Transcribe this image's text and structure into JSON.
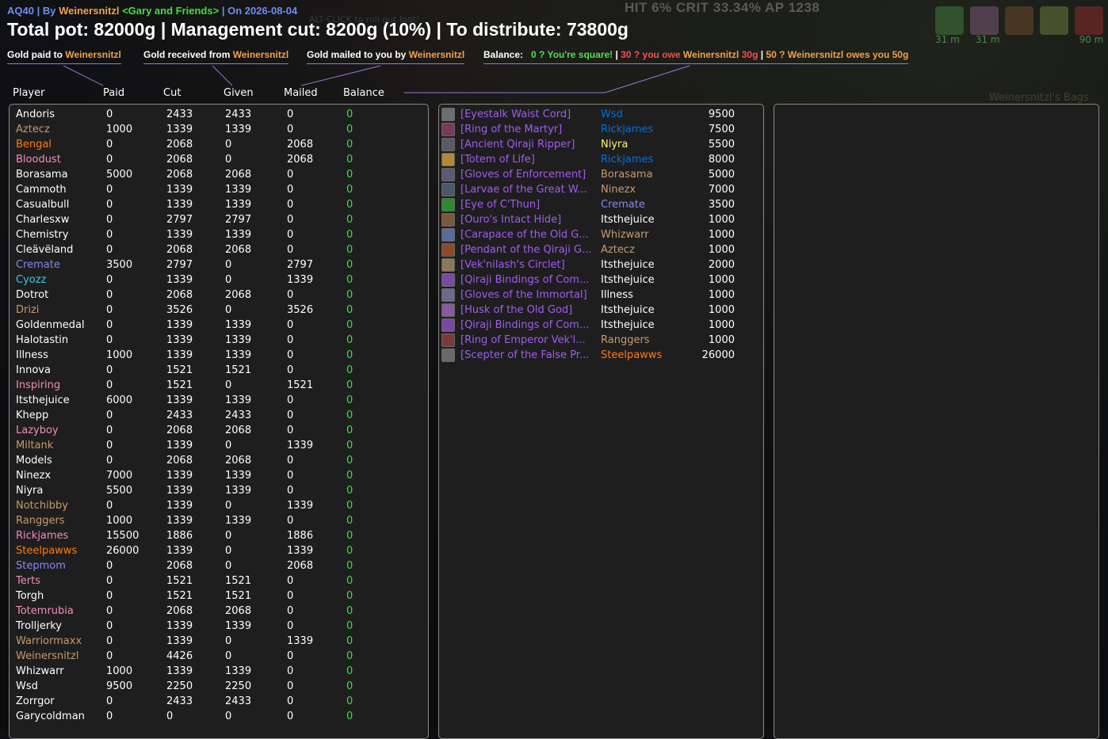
{
  "header": {
    "raid": "AQ40",
    "by_label": "By",
    "author": "Weinersnitzl",
    "guild": "<Gary and Friends>",
    "on_label": "On",
    "date": "2026-08-04",
    "title": "Total pot: 82000g | Management cut: 8200g (10%) | To distribute: 73800g"
  },
  "background": {
    "hud_stats": "HIT 6%  CRIT 33.34%   AP 1238",
    "alt_hint": "ALT-CLICK to roll out loot!",
    "bags_title": "Weinersnitzl's Bags",
    "timers": [
      "31 m",
      "31 m",
      "",
      "",
      "90 m"
    ]
  },
  "legend": {
    "paid_prefix": "Gold paid to",
    "paid_name": "Weinersnitzl",
    "received_prefix": "Gold received from",
    "received_name": "Weinersnitzl",
    "mailed_prefix": "Gold mailed to you by",
    "mailed_name": "Weinersnitzl",
    "balance_label": "Balance:",
    "bal_zero": "0 ? You're square!",
    "bal_sep1": "|",
    "bal_neg_a": "30 ? you owe",
    "bal_neg_name": "Weinersnitzl",
    "bal_neg_b": "30g",
    "bal_sep2": "|",
    "bal_pos_a": "50 ? Weinersnitzl",
    "bal_pos_b": "owes you 50g"
  },
  "columns": {
    "player": "Player",
    "paid": "Paid",
    "cut": "Cut",
    "given": "Given",
    "mailed": "Mailed",
    "balance": "Balance"
  },
  "players": [
    {
      "name": "Andoris",
      "color": "#ffffff",
      "paid": "0",
      "cut": "2433",
      "given": "2433",
      "mailed": "0",
      "balance": "0"
    },
    {
      "name": "Aztecz",
      "color": "#c69b6d",
      "paid": "1000",
      "cut": "1339",
      "given": "1339",
      "mailed": "0",
      "balance": "0"
    },
    {
      "name": "Bengal",
      "color": "#ff7c0a",
      "paid": "0",
      "cut": "2068",
      "given": "0",
      "mailed": "2068",
      "balance": "0"
    },
    {
      "name": "Bloodust",
      "color": "#f48cba",
      "paid": "0",
      "cut": "2068",
      "given": "0",
      "mailed": "2068",
      "balance": "0"
    },
    {
      "name": "Borasama",
      "color": "#ffffff",
      "paid": "5000",
      "cut": "2068",
      "given": "2068",
      "mailed": "0",
      "balance": "0"
    },
    {
      "name": "Cammoth",
      "color": "#ffffff",
      "paid": "0",
      "cut": "1339",
      "given": "1339",
      "mailed": "0",
      "balance": "0"
    },
    {
      "name": "Casualbull",
      "color": "#ffffff",
      "paid": "0",
      "cut": "1339",
      "given": "1339",
      "mailed": "0",
      "balance": "0"
    },
    {
      "name": "Charlesxw",
      "color": "#ffffff",
      "paid": "0",
      "cut": "2797",
      "given": "2797",
      "mailed": "0",
      "balance": "0"
    },
    {
      "name": "Chemistry",
      "color": "#ffffff",
      "paid": "0",
      "cut": "1339",
      "given": "1339",
      "mailed": "0",
      "balance": "0"
    },
    {
      "name": "Cleävëland",
      "color": "#ffffff",
      "paid": "0",
      "cut": "2068",
      "given": "2068",
      "mailed": "0",
      "balance": "0"
    },
    {
      "name": "Cremate",
      "color": "#8788ee",
      "paid": "3500",
      "cut": "2797",
      "given": "0",
      "mailed": "2797",
      "balance": "0"
    },
    {
      "name": "Cyozz",
      "color": "#3fc7eb",
      "paid": "0",
      "cut": "1339",
      "given": "0",
      "mailed": "1339",
      "balance": "0"
    },
    {
      "name": "Dotrot",
      "color": "#ffffff",
      "paid": "0",
      "cut": "2068",
      "given": "2068",
      "mailed": "0",
      "balance": "0"
    },
    {
      "name": "Drizi",
      "color": "#c69b6d",
      "paid": "0",
      "cut": "3526",
      "given": "0",
      "mailed": "3526",
      "balance": "0"
    },
    {
      "name": "Goldenmedal",
      "color": "#ffffff",
      "paid": "0",
      "cut": "1339",
      "given": "1339",
      "mailed": "0",
      "balance": "0"
    },
    {
      "name": "Halotastin",
      "color": "#ffffff",
      "paid": "0",
      "cut": "1339",
      "given": "1339",
      "mailed": "0",
      "balance": "0"
    },
    {
      "name": "Illness",
      "color": "#ffffff",
      "paid": "1000",
      "cut": "1339",
      "given": "1339",
      "mailed": "0",
      "balance": "0"
    },
    {
      "name": "Innova",
      "color": "#ffffff",
      "paid": "0",
      "cut": "1521",
      "given": "1521",
      "mailed": "0",
      "balance": "0"
    },
    {
      "name": "Inspiring",
      "color": "#f48cba",
      "paid": "0",
      "cut": "1521",
      "given": "0",
      "mailed": "1521",
      "balance": "0"
    },
    {
      "name": "Itsthejuice",
      "color": "#ffffff",
      "paid": "6000",
      "cut": "1339",
      "given": "1339",
      "mailed": "0",
      "balance": "0"
    },
    {
      "name": "Khepp",
      "color": "#ffffff",
      "paid": "0",
      "cut": "2433",
      "given": "2433",
      "mailed": "0",
      "balance": "0"
    },
    {
      "name": "Lazyboy",
      "color": "#f48cba",
      "paid": "0",
      "cut": "2068",
      "given": "2068",
      "mailed": "0",
      "balance": "0"
    },
    {
      "name": "Miltank",
      "color": "#c69b6d",
      "paid": "0",
      "cut": "1339",
      "given": "0",
      "mailed": "1339",
      "balance": "0"
    },
    {
      "name": "Models",
      "color": "#ffffff",
      "paid": "0",
      "cut": "2068",
      "given": "2068",
      "mailed": "0",
      "balance": "0"
    },
    {
      "name": "Ninezx",
      "color": "#ffffff",
      "paid": "7000",
      "cut": "1339",
      "given": "1339",
      "mailed": "0",
      "balance": "0"
    },
    {
      "name": "Niyra",
      "color": "#ffffff",
      "paid": "5500",
      "cut": "1339",
      "given": "1339",
      "mailed": "0",
      "balance": "0"
    },
    {
      "name": "Notchibby",
      "color": "#c69b6d",
      "paid": "0",
      "cut": "1339",
      "given": "0",
      "mailed": "1339",
      "balance": "0"
    },
    {
      "name": "Ranggers",
      "color": "#c69b6d",
      "paid": "1000",
      "cut": "1339",
      "given": "1339",
      "mailed": "0",
      "balance": "0"
    },
    {
      "name": "Rickjames",
      "color": "#f48cba",
      "paid": "15500",
      "cut": "1886",
      "given": "0",
      "mailed": "1886",
      "balance": "0"
    },
    {
      "name": "Steelpawws",
      "color": "#ff7c0a",
      "paid": "26000",
      "cut": "1339",
      "given": "0",
      "mailed": "1339",
      "balance": "0"
    },
    {
      "name": "Stepmom",
      "color": "#8788ee",
      "paid": "0",
      "cut": "2068",
      "given": "0",
      "mailed": "2068",
      "balance": "0"
    },
    {
      "name": "Terts",
      "color": "#f48cba",
      "paid": "0",
      "cut": "1521",
      "given": "1521",
      "mailed": "0",
      "balance": "0"
    },
    {
      "name": "Torgh",
      "color": "#ffffff",
      "paid": "0",
      "cut": "1521",
      "given": "1521",
      "mailed": "0",
      "balance": "0"
    },
    {
      "name": "Totemrubia",
      "color": "#f48cba",
      "paid": "0",
      "cut": "2068",
      "given": "2068",
      "mailed": "0",
      "balance": "0"
    },
    {
      "name": "Trolljerky",
      "color": "#ffffff",
      "paid": "0",
      "cut": "1339",
      "given": "1339",
      "mailed": "0",
      "balance": "0"
    },
    {
      "name": "Warriormaxx",
      "color": "#c69b6d",
      "paid": "0",
      "cut": "1339",
      "given": "0",
      "mailed": "1339",
      "balance": "0"
    },
    {
      "name": "Weinersnitzl",
      "color": "#c69b6d",
      "paid": "0",
      "cut": "4426",
      "given": "0",
      "mailed": "0",
      "balance": "0"
    },
    {
      "name": "Whizwarr",
      "color": "#ffffff",
      "paid": "1000",
      "cut": "1339",
      "given": "1339",
      "mailed": "0",
      "balance": "0"
    },
    {
      "name": "Wsd",
      "color": "#ffffff",
      "paid": "9500",
      "cut": "2250",
      "given": "2250",
      "mailed": "0",
      "balance": "0"
    },
    {
      "name": "Zorrgor",
      "color": "#ffffff",
      "paid": "0",
      "cut": "2433",
      "given": "2433",
      "mailed": "0",
      "balance": "0"
    },
    {
      "name": "Garycoldman",
      "color": "#ffffff",
      "paid": "0",
      "cut": "0",
      "given": "0",
      "mailed": "0",
      "balance": "0"
    }
  ],
  "items": [
    {
      "name": "[Eyestalk Waist Cord]",
      "winner": "Wsd",
      "winner_color": "#0070dd",
      "price": "9500",
      "icon": "belt-icon",
      "icon_color": "#6d6d6d"
    },
    {
      "name": "[Ring of the Martyr]",
      "winner": "Rickjames",
      "winner_color": "#0070dd",
      "price": "7500",
      "icon": "ring-icon",
      "icon_color": "#7a3b5a"
    },
    {
      "name": "[Ancient Qiraji Ripper]",
      "winner": "Niyra",
      "winner_color": "#fff569",
      "price": "5500",
      "icon": "sword-icon",
      "icon_color": "#5a5a66"
    },
    {
      "name": "[Totem of Life]",
      "winner": "Rickjames",
      "winner_color": "#0070dd",
      "price": "8000",
      "icon": "totem-icon",
      "icon_color": "#b08a3a"
    },
    {
      "name": "[Gloves of Enforcement]",
      "winner": "Borasama",
      "winner_color": "#c69b6d",
      "price": "5000",
      "icon": "gloves-icon",
      "icon_color": "#5a5a75"
    },
    {
      "name": "[Larvae of the Great W...",
      "winner": "Ninezx",
      "winner_color": "#c69b6d",
      "price": "7000",
      "icon": "larvae-icon",
      "icon_color": "#4a5a6a"
    },
    {
      "name": "[Eye of C'Thun]",
      "winner": "Cremate",
      "winner_color": "#8788ee",
      "price": "3500",
      "icon": "eye-icon",
      "icon_color": "#2f8a2f"
    },
    {
      "name": "[Ouro's Intact Hide]",
      "winner": "Itsthejuice",
      "winner_color": "#ffffff",
      "price": "1000",
      "icon": "hide-icon",
      "icon_color": "#7a5a3a"
    },
    {
      "name": "[Carapace of the Old G...",
      "winner": "Whizwarr",
      "winner_color": "#c69b6d",
      "price": "1000",
      "icon": "carapace-icon",
      "icon_color": "#5a6a9a"
    },
    {
      "name": "[Pendant of the Qiraji G...",
      "winner": "Aztecz",
      "winner_color": "#c69b6d",
      "price": "1000",
      "icon": "pendant-icon",
      "icon_color": "#8a4a2a"
    },
    {
      "name": "[Vek'nilash's Circlet]",
      "winner": "Itsthejuice",
      "winner_color": "#ffffff",
      "price": "2000",
      "icon": "circlet-icon",
      "icon_color": "#8a7a5a"
    },
    {
      "name": "[Qiraji Bindings of Com...",
      "winner": "Itsthejuice",
      "winner_color": "#ffffff",
      "price": "1000",
      "icon": "bindings-icon",
      "icon_color": "#7a4aa0"
    },
    {
      "name": "[Gloves of the Immortal]",
      "winner": "Illness",
      "winner_color": "#ffffff",
      "price": "1000",
      "icon": "gloves-icon",
      "icon_color": "#6a6a8a"
    },
    {
      "name": "[Husk of the Old God]",
      "winner": "Itsthejuice",
      "winner_color": "#ffffff",
      "price": "1000",
      "icon": "husk-icon",
      "icon_color": "#8a5aa0"
    },
    {
      "name": "[Qiraji Bindings of Com...",
      "winner": "Itsthejuice",
      "winner_color": "#ffffff",
      "price": "1000",
      "icon": "bindings-icon",
      "icon_color": "#7a4aa0"
    },
    {
      "name": "[Ring of Emperor Vek'l...",
      "winner": "Ranggers",
      "winner_color": "#c69b6d",
      "price": "1000",
      "icon": "ring-icon",
      "icon_color": "#7a3b3b"
    },
    {
      "name": "[Scepter of the False Pr...",
      "winner": "Steelpawws",
      "winner_color": "#ff7c0a",
      "price": "26000",
      "icon": "scepter-icon",
      "icon_color": "#6a6a6a"
    }
  ]
}
